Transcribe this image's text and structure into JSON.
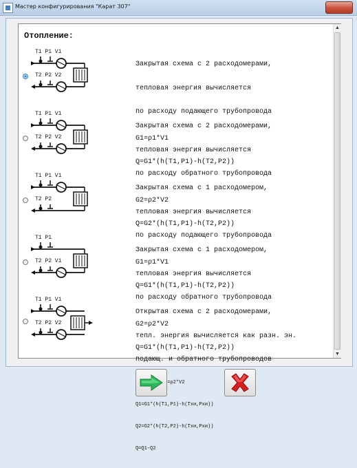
{
  "window": {
    "title": "Мастер конфигурирования \"Карат 307\""
  },
  "panel": {
    "heading": "Отопление:",
    "options": [
      {
        "checked": true,
        "schema": {
          "top_labels": "T1 P1 V1",
          "bottom_labels": "T2 P2 V2",
          "flowmeters": 2
        },
        "lines": [
          "Закрытая схема с 2 расходомерами,",
          "тепловая энергия вычисляется",
          "по расходу подающего трубопровода",
          "G1=ρ1*V1",
          "Q=G1*(h(T1,P1)-h(T2,P2))"
        ]
      },
      {
        "checked": false,
        "schema": {
          "top_labels": "T1 P1 V1",
          "bottom_labels": "T2 P2 V2",
          "flowmeters": 2
        },
        "lines": [
          "Закрытая схема с 2 расходомерами,",
          "тепловая энергия вычисляется",
          "по расходу обратного трубопровода",
          "G2=ρ2*V2",
          "Q=G2*(h(T1,P1)-h(T2,P2))"
        ]
      },
      {
        "checked": false,
        "schema": {
          "top_labels": "T1 P1 V1",
          "bottom_labels": "T2 P2",
          "flowmeters": 1
        },
        "lines": [
          "Закрытая схема с 1 расходомером,",
          "тепловая энергия вычисляется",
          "по расходу подающего трубопровода",
          "G1=ρ1*V1",
          "Q=G1*(h(T1,P1)-h(T2,P2))"
        ]
      },
      {
        "checked": false,
        "schema": {
          "top_labels": "T1 P1",
          "bottom_labels": "T2 P2 V1",
          "flowmeters": 1
        },
        "lines": [
          "Закрытая схема с 1 расходомером,",
          "тепловая энергия вычисляется",
          "по расходу обратного трубопровода",
          "G2=ρ2*V2",
          "Q=G1*(h(T1,P1)-h(T2,P2))"
        ]
      },
      {
        "checked": false,
        "schema": {
          "top_labels": "T1 P1 V1",
          "bottom_labels": "T2 P2 V2",
          "flowmeters": 2
        },
        "lines": [
          "Открытая схема с 2 расходомерами,",
          "тепл. энергия вычисляется как разн. эн.",
          "подающ. и обратного трубопроводов"
        ],
        "small_lines": [
          "G1=ρ1*V1 G2=ρ2*V2",
          "Q1=G1*(h(T1,P1)-h(Tхи,Pхи))",
          "Q2=G2*(h(T2,P2)-h(Tхи,Pхи))",
          "Q=Q1-Q2"
        ]
      }
    ]
  },
  "buttons": {
    "next_icon": "green-arrow-right-icon",
    "cancel_icon": "red-cross-icon"
  },
  "colors": {
    "accent_green": "#2db85a",
    "cancel_red": "#d81e1e"
  }
}
